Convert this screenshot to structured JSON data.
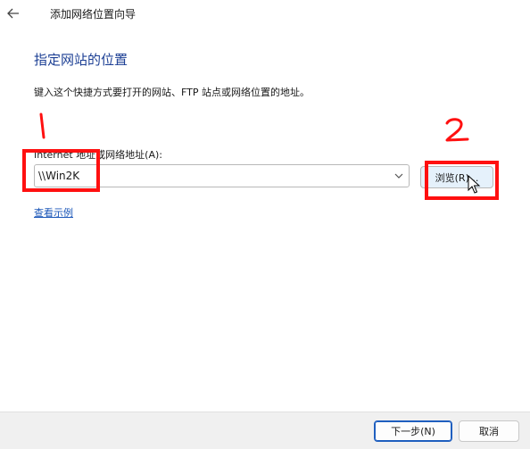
{
  "window": {
    "title": "添加网络位置向导"
  },
  "page": {
    "heading": "指定网站的位置",
    "description": "键入这个快捷方式要打开的网站、FTP 站点或网络位置的地址。",
    "address_label": "Internet 地址或网络地址(A):",
    "address_value": "\\\\Win2K",
    "browse_label": "浏览(R)...",
    "example_link": "查看示例"
  },
  "footer": {
    "next_label": "下一步(N)",
    "cancel_label": "取消"
  },
  "annotations": {
    "mark_1": "1",
    "mark_2": "2",
    "color": "#ff1010"
  },
  "icons": {
    "back": "back-arrow-icon",
    "dropdown": "chevron-down-icon",
    "cursor": "mouse-pointer-icon"
  },
  "colors": {
    "heading": "#1c3f94",
    "link": "#1a56b8",
    "primary_button_border": "#1f5fbf"
  }
}
